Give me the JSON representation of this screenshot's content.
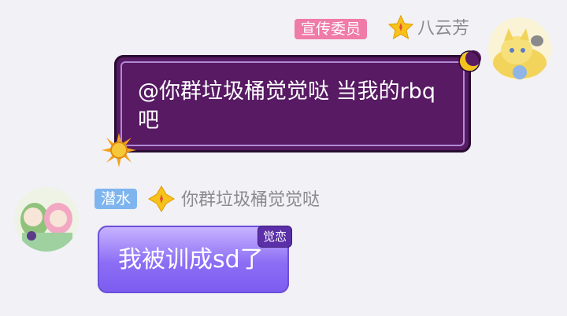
{
  "messages": [
    {
      "side": "right",
      "badge": "宣传委员",
      "badge_color": "#f07aa8",
      "nickname": "八云芳",
      "text": "@你群垃圾桶觉觉哒 当我的rbq吧",
      "bubble_color": "#571a63"
    },
    {
      "side": "left",
      "badge": "潜水",
      "badge_color": "#7fb5ef",
      "nickname": "你群垃圾桶觉觉哒",
      "text": "我被训成sd了",
      "bubble_tag": "觉恋",
      "bubble_color": "#8c6ef5"
    }
  ],
  "icons": {
    "level_right": "star-level-icon",
    "level_left": "diamond-level-icon",
    "bubble_decoration_right": [
      "moon-icon",
      "sun-icon"
    ]
  }
}
